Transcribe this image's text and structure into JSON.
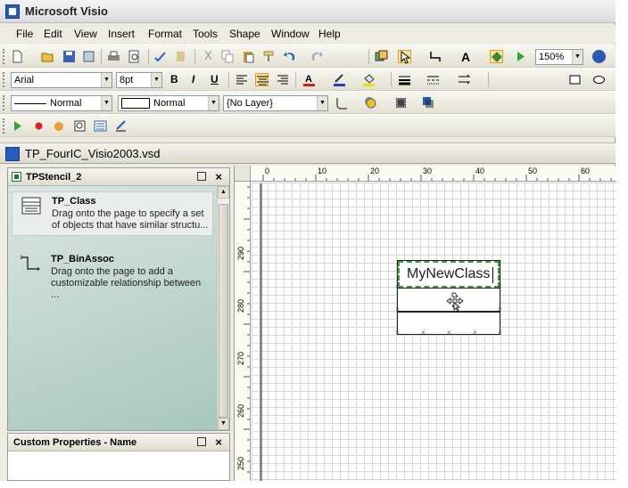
{
  "window": {
    "title": "Microsoft Visio"
  },
  "menu": [
    "File",
    "Edit",
    "View",
    "Insert",
    "Format",
    "Tools",
    "Shape",
    "Window",
    "Help"
  ],
  "standard_toolbar": {
    "zoom": "150%"
  },
  "formatting_toolbar": {
    "font": "Arial",
    "size": "8pt",
    "bold": "B",
    "italic": "I",
    "underline": "U",
    "text_button": "A"
  },
  "format_shape_toolbar": {
    "line_style": "Normal",
    "fill_style": "Normal",
    "layer": "{No Layer}"
  },
  "document": {
    "title": "TP_FourIC_Visio2003.vsd"
  },
  "stencil": {
    "title": "TPStencil_2",
    "items": [
      {
        "name": "TP_Class",
        "desc1": "Drag onto the page to specify a set",
        "desc2": "of objects that have similar structu..."
      },
      {
        "name": "TP_BinAssoc",
        "desc1": "Drag onto the page to add a",
        "desc2": "customizable relationship between ..."
      }
    ]
  },
  "custom_properties": {
    "title": "Custom Properties - Name"
  },
  "rulers": {
    "top": [
      "0",
      "10",
      "20",
      "30",
      "40",
      "50",
      "60"
    ],
    "left": [
      "290",
      "280",
      "270",
      "260",
      "250"
    ]
  },
  "shape": {
    "class_name": "MyNewClass"
  }
}
